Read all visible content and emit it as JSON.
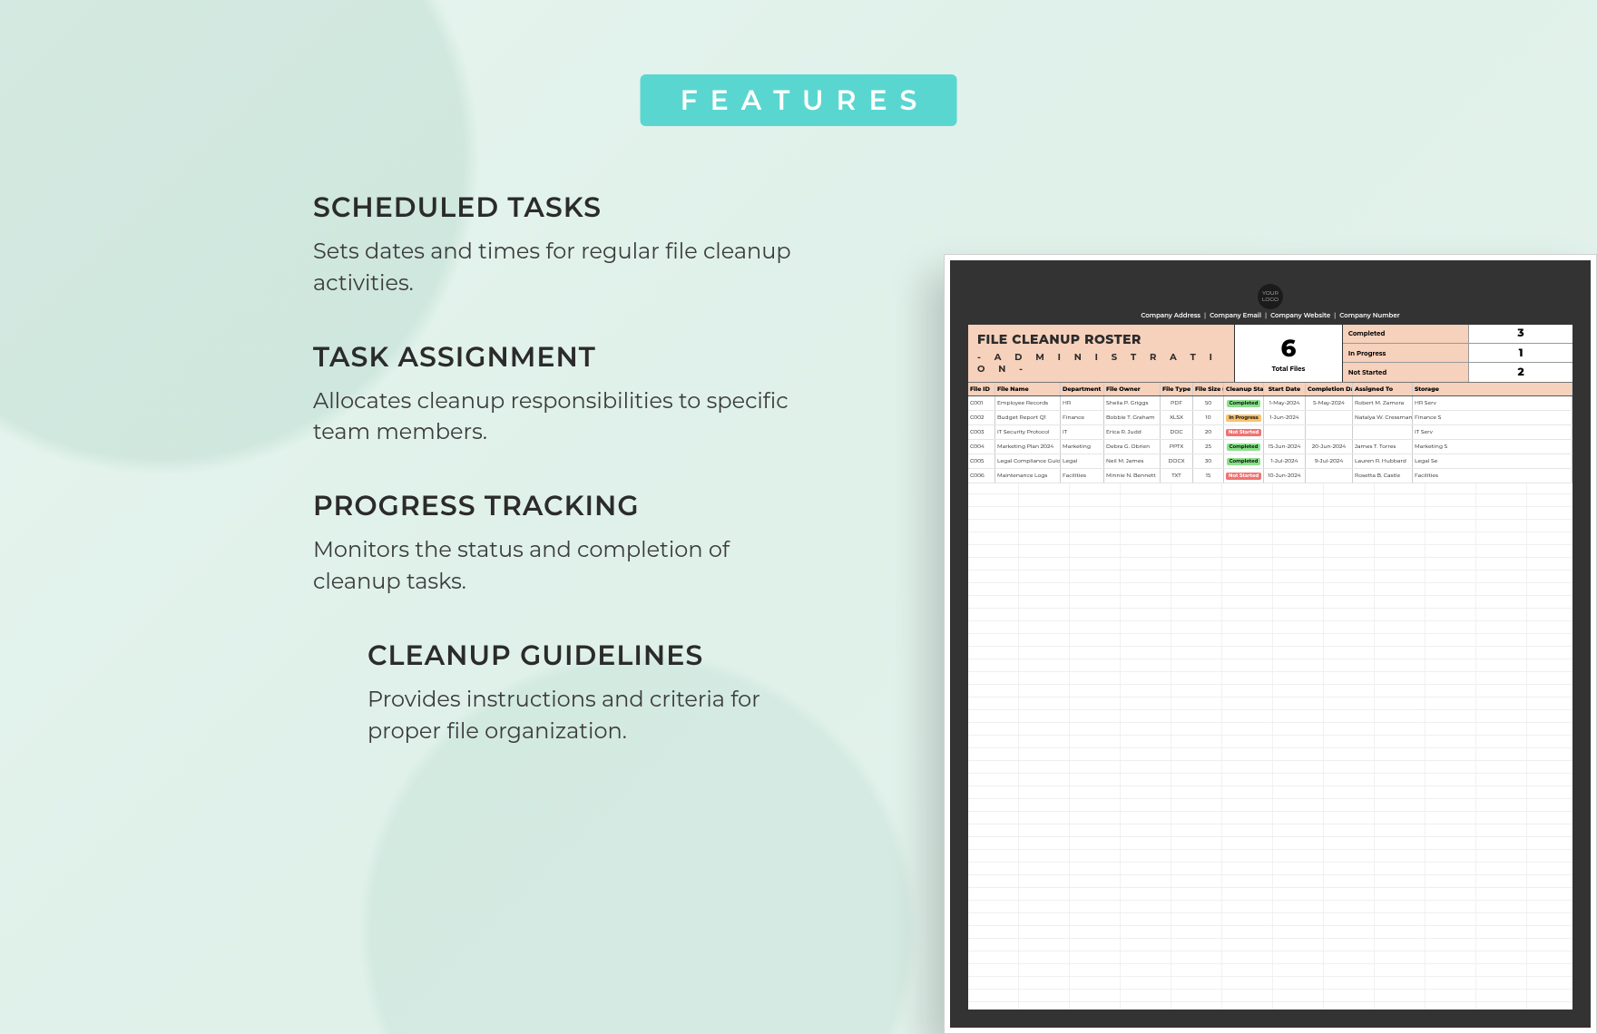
{
  "badge": "FEATURES",
  "features": [
    {
      "title": "SCHEDULED TASKS",
      "desc": "Sets dates and times for regular file cleanup activities.",
      "indent": false
    },
    {
      "title": "TASK ASSIGNMENT",
      "desc": "Allocates cleanup responsibilities to specific team members.",
      "indent": false
    },
    {
      "title": "PROGRESS TRACKING",
      "desc": "Monitors the status and completion of cleanup tasks.",
      "indent": false
    },
    {
      "title": "CLEANUP GUIDELINES",
      "desc": "Provides instructions and criteria for proper file organization.",
      "indent": true
    }
  ],
  "sheet": {
    "logo_text": "YOUR LOGO",
    "company_line": [
      "Company Address",
      "Company Email",
      "Company Website",
      "Company Number"
    ],
    "title": "FILE CLEANUP ROSTER",
    "subtitle": "- A D M I N I S T R A T I O N -",
    "total_value": "6",
    "total_label": "Total Files",
    "status_counts": [
      {
        "label": "Completed",
        "value": "3"
      },
      {
        "label": "In Progress",
        "value": "1"
      },
      {
        "label": "Not Started",
        "value": "2"
      }
    ],
    "columns": [
      "File ID",
      "File Name",
      "Department",
      "File Owner",
      "File Type",
      "File Size (MB)",
      "Cleanup Status",
      "Start Date",
      "Completion Date",
      "Assigned To",
      "Storage"
    ],
    "rows": [
      {
        "id": "C001",
        "name": "Employee Records",
        "dept": "HR",
        "owner": "Sheila P. Griggs",
        "type": "PDF",
        "size": "50",
        "status": "Completed",
        "start": "1-May-2024",
        "end": "5-May-2024",
        "assigned": "Robert M. Zamora",
        "store": "HR Serv"
      },
      {
        "id": "C002",
        "name": "Budget Report Q1",
        "dept": "Finance",
        "owner": "Bobbie T. Graham",
        "type": "XLSX",
        "size": "10",
        "status": "In Progress",
        "start": "1-Jun-2024",
        "end": "",
        "assigned": "Natalya W. Cressman",
        "store": "Finance S"
      },
      {
        "id": "C003",
        "name": "IT Security Protocol",
        "dept": "IT",
        "owner": "Erica R. Judd",
        "type": "DOC",
        "size": "20",
        "status": "Not Started",
        "start": "",
        "end": "",
        "assigned": "",
        "store": "IT Serv"
      },
      {
        "id": "C004",
        "name": "Marketing Plan 2024",
        "dept": "Marketing",
        "owner": "Debra G. Obrien",
        "type": "PPTX",
        "size": "25",
        "status": "Completed",
        "start": "15-Jun-2024",
        "end": "20-Jun-2024",
        "assigned": "James T. Torres",
        "store": "Marketing S"
      },
      {
        "id": "C005",
        "name": "Legal Compliance Guide",
        "dept": "Legal",
        "owner": "Neil M. James",
        "type": "DOCX",
        "size": "30",
        "status": "Completed",
        "start": "1-Jul-2024",
        "end": "9-Jul-2024",
        "assigned": "Lauren R. Hubbard",
        "store": "Legal Se"
      },
      {
        "id": "C006",
        "name": "Maintenance Logs",
        "dept": "Facilities",
        "owner": "Minnie N. Bennett",
        "type": "TXT",
        "size": "15",
        "status": "Not Started",
        "start": "10-Jun-2024",
        "end": "",
        "assigned": "Rosetta B. Castle",
        "store": "Facilities"
      }
    ]
  }
}
